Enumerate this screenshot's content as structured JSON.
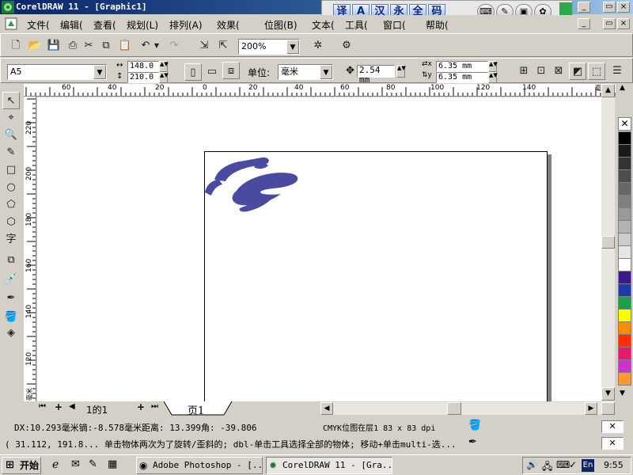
{
  "window": {
    "title": "CorelDRAW 11 - [Graphic1]",
    "buttons": {
      "minimize": "_",
      "restore": "▭",
      "close": "×"
    }
  },
  "ime": {
    "keys": [
      "译",
      "A",
      "汉",
      "永",
      "全",
      "码"
    ]
  },
  "menu": {
    "items": [
      "文件(",
      "编辑(",
      "查看(",
      "规划(L)",
      "排列(A)",
      "效果(",
      "位图(B)",
      "文本(",
      "工具(",
      "窗口(",
      "帮助("
    ]
  },
  "toolbar": {
    "zoom": "200%"
  },
  "property_bar": {
    "paper": "A5",
    "width": "148.0 n",
    "height": "210.0 n",
    "unit_label": "单位:",
    "unit_value": "毫米",
    "nudge": "2.54 mm",
    "dup_x": "6.35 mm",
    "dup_y": "6.35 mm"
  },
  "rulers": {
    "h_labels": [
      "60",
      "40",
      "20",
      "0",
      "20",
      "40",
      "60",
      "80",
      "100",
      "120",
      "140"
    ],
    "h_unit": "毫米",
    "v_labels": [
      "220",
      "200",
      "180",
      "160",
      "140",
      "120"
    ],
    "v_unit": "毫米"
  },
  "page_tabs": {
    "label_left": "1的1",
    "current": "页1"
  },
  "status": {
    "line1_left": "DX:10.293毫米镝:-8.578毫米距离: 13.399角: -39.806",
    "line1_right": "CMYK位图在层1 83 x 83 dpi",
    "line2": "( 31.112, 191.8... 单击物体两次为了旋转/歪斜的; dbl-单击工具选择全部的物体; 移动+单击multi-选..."
  },
  "taskbar": {
    "start": "开始",
    "tasks": [
      "Adobe Photoshop - [...",
      "CorelDRAW 11 - [Gra..."
    ],
    "lang": "En",
    "clock": "9:55"
  },
  "palette": {
    "colors": [
      "#000000",
      "#1a1a1a",
      "#333333",
      "#4d4d4d",
      "#666666",
      "#808080",
      "#999999",
      "#b3b3b3",
      "#cccccc",
      "#e6e6e6",
      "#ffffff",
      "#3a1a8a",
      "#1f3aa8",
      "#1c9e4b",
      "#ffff00",
      "#ff8c00",
      "#ff2e00",
      "#e6196e",
      "#cc33cc",
      "#ff9933"
    ]
  },
  "colors": {
    "logo_blue": "#4a4aa0",
    "title_dark": "#0a246a",
    "title_light": "#a6caf0"
  }
}
